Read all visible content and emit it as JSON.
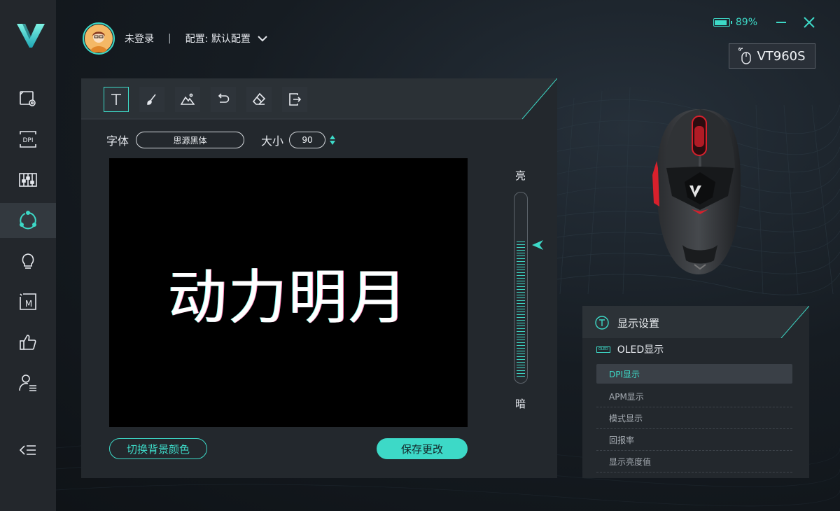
{
  "header": {
    "login_status": "未登录",
    "separator": "|",
    "profile_label": "配置: 默认配置"
  },
  "status": {
    "battery": "89%",
    "battery_level": 0.89
  },
  "device": {
    "name": "VT960S"
  },
  "sidebar": {
    "items": [
      {
        "name": "image-settings-icon"
      },
      {
        "name": "dpi-icon"
      },
      {
        "name": "equalizer-icon"
      },
      {
        "name": "sync-icon",
        "active": true
      },
      {
        "name": "lightbulb-icon"
      },
      {
        "name": "macro-icon"
      },
      {
        "name": "thumbs-up-icon"
      },
      {
        "name": "user-list-icon"
      }
    ]
  },
  "editor": {
    "tools": [
      "text-tool-icon",
      "brush-tool-icon",
      "image-tool-icon",
      "undo-icon",
      "eraser-icon",
      "export-icon"
    ],
    "font_label": "字体",
    "font_value": "思源黑体",
    "size_label": "大小",
    "size_value": "90",
    "canvas_text": "动力明月",
    "brightness_high": "亮",
    "brightness_low": "暗",
    "brightness_level": 0.75,
    "switch_bg_button": "切换背景颜色",
    "save_button": "保存更改"
  },
  "display_settings": {
    "title": "显示设置",
    "oled_tag": "OLED",
    "oled_label": "OLED显示",
    "items": [
      "DPI显示",
      "APM显示",
      "模式显示",
      "回报率",
      "显示亮度值"
    ],
    "active_index": 0
  },
  "colors": {
    "accent": "#3dd9c7",
    "panel": "#23282d",
    "sidebar": "#23272c",
    "mouse_red": "#d8202c"
  }
}
